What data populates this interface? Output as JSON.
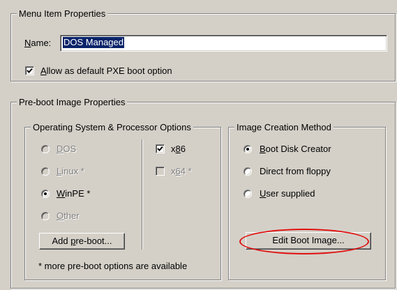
{
  "menu_item_properties": {
    "legend": "Menu Item Properties",
    "name_label": "Name:",
    "name_mnemonic": "N",
    "name_label_rest": "ame:",
    "name_value": "DOS Managed",
    "allow_default_mnemonic": "A",
    "allow_default_rest": "llow as default PXE boot option",
    "allow_default_checked": true
  },
  "preboot": {
    "legend": "Pre-boot Image Properties",
    "os_group": {
      "legend": "Operating System & Processor Options",
      "dos_mn": "D",
      "dos_rest": "OS",
      "linux_mn": "L",
      "linux_rest": "inux *",
      "winpe_mn": "W",
      "winpe_rest": "inPE *",
      "other_mn": "O",
      "other_rest": "ther",
      "x86_pre": "x",
      "x86_mn": "8",
      "x86_rest": "6",
      "x64_pre": "x",
      "x64_mn": "6",
      "x64_rest": "4 *",
      "add_pre": "Add ",
      "add_mn": "p",
      "add_rest": "re-boot...",
      "note": "* more pre-boot options are available"
    },
    "method_group": {
      "legend": "Image Creation Method",
      "bdc_mn": "B",
      "bdc_rest": "oot Disk Creator",
      "floppy_label": "Direct from floppy",
      "user_mn": "U",
      "user_rest": "ser supplied",
      "edit_label": "Edit Boot Image..."
    }
  },
  "colors": {
    "highlight_circle": "#e01010",
    "selection": "#0a246a"
  }
}
